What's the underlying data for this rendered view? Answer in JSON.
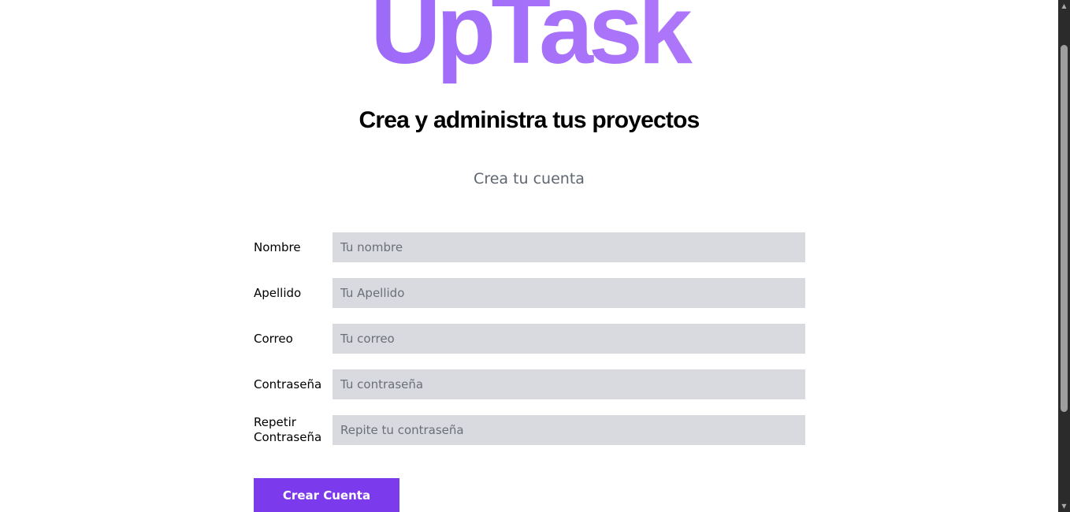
{
  "app": {
    "logo_text": "UpTask",
    "tagline": "Crea y administra tus proyectos",
    "subtitle": "Crea tu cuenta"
  },
  "form": {
    "fields": [
      {
        "label": "Nombre",
        "placeholder": "Tu nombre",
        "value": ""
      },
      {
        "label": "Apellido",
        "placeholder": "Tu Apellido",
        "value": ""
      },
      {
        "label": "Correo",
        "placeholder": "Tu correo",
        "value": ""
      },
      {
        "label": "Contraseña",
        "placeholder": "Tu contraseña",
        "value": ""
      },
      {
        "label": "Repetir Contraseña",
        "placeholder": "Repite tu contraseña",
        "value": ""
      }
    ],
    "submit_label": "Crear Cuenta"
  },
  "colors": {
    "brand_gradient_start": "#8b5cf6",
    "brand_gradient_end": "#c084fc",
    "button": "#7c3aed",
    "input_background": "#d9dae0"
  },
  "scrollbar": {
    "up_icon": "scroll-up-arrow-icon",
    "down_icon": "scroll-down-arrow-icon"
  }
}
